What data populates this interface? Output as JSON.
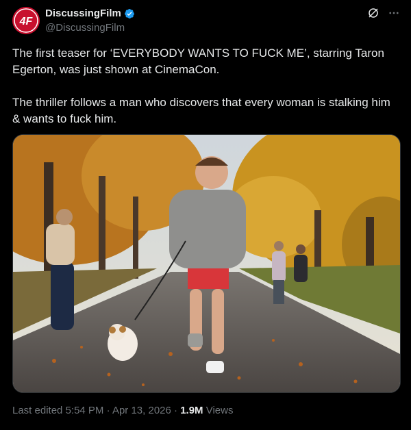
{
  "author": {
    "display_name": "DiscussingFilm",
    "handle": "@DiscussingFilm",
    "avatar_text": "DF",
    "avatar_color": "#c8102e",
    "verified_color": "#1d9bf0"
  },
  "tweet": {
    "paragraph_1": "The first teaser for ‘EVERYBODY WANTS TO FUCK ME’, starring Taron Egerton, was just shown at CinemaCon.",
    "paragraph_2": "The thriller follows a man who discovers that every woman is stalking him & wants to fuck him."
  },
  "meta": {
    "edited_prefix": "Last edited",
    "time": "5:54 PM",
    "date": "Apr 13, 2026",
    "separator": "·",
    "views_count": "1.9M",
    "views_label": "Views"
  },
  "icons": {
    "grok": "grok-icon",
    "more": "more-icon",
    "verified": "verified-badge-icon"
  }
}
